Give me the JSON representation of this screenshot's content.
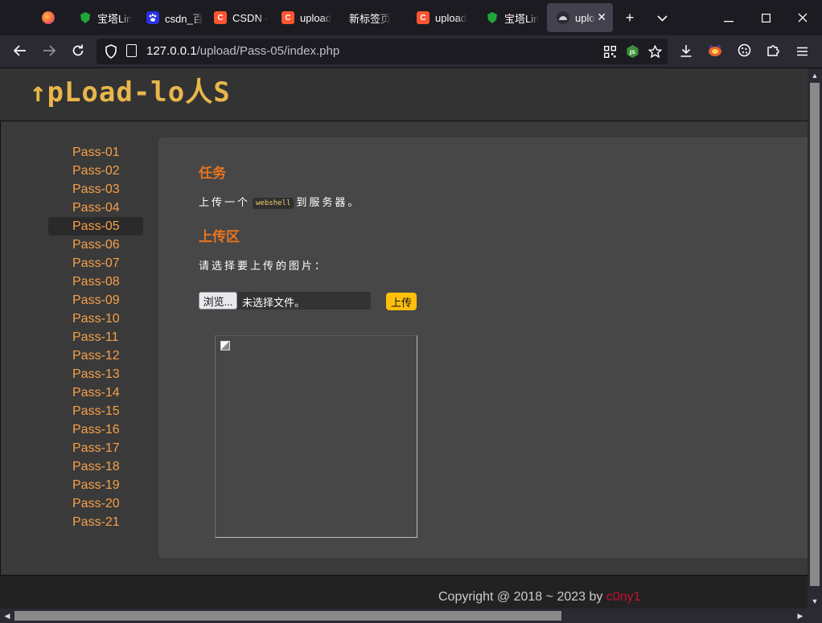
{
  "browser": {
    "tabs": [
      {
        "title": "",
        "favicon": "firefox-view-icon"
      },
      {
        "title": "宝塔Lin",
        "favicon": "baota-icon"
      },
      {
        "title": "csdn_百",
        "favicon": "baidu-icon"
      },
      {
        "title": "CSDN -",
        "favicon": "csdn-icon"
      },
      {
        "title": "upload",
        "favicon": "csdn-icon"
      },
      {
        "title": "新标签页",
        "favicon": ""
      },
      {
        "title": "upload",
        "favicon": "csdn-icon"
      },
      {
        "title": "宝塔Lin",
        "favicon": "baota-icon"
      },
      {
        "title": "uplo",
        "favicon": "upload-icon"
      }
    ],
    "url_host": "127.0.0.1",
    "url_path": "/upload/Pass-05/index.php"
  },
  "page": {
    "logo": "↑pLoad-lo人S",
    "menu": [
      "Pass-01",
      "Pass-02",
      "Pass-03",
      "Pass-04",
      "Pass-05",
      "Pass-06",
      "Pass-07",
      "Pass-08",
      "Pass-09",
      "Pass-10",
      "Pass-11",
      "Pass-12",
      "Pass-13",
      "Pass-14",
      "Pass-15",
      "Pass-16",
      "Pass-17",
      "Pass-18",
      "Pass-19",
      "Pass-20",
      "Pass-21"
    ],
    "active_menu": "Pass-05",
    "task_title": "任务",
    "task_prefix": "上传一个",
    "task_code": "webshell",
    "task_suffix": "到服务器。",
    "upload_title": "上传区",
    "select_prompt": "请选择要上传的图片：",
    "browse_label": "浏览...",
    "no_file_label": "未选择文件。",
    "upload_button": "上传",
    "footer_text": "Copyright @ 2018 ~ 2023 by ",
    "footer_author": "c0ny1"
  },
  "colors": {
    "accent_orange": "#e8741e",
    "menu_link": "#f5a04a",
    "logo_gold": "#e8b64a",
    "upload_button": "#ffbf0b",
    "author_red": "#c8102e"
  }
}
